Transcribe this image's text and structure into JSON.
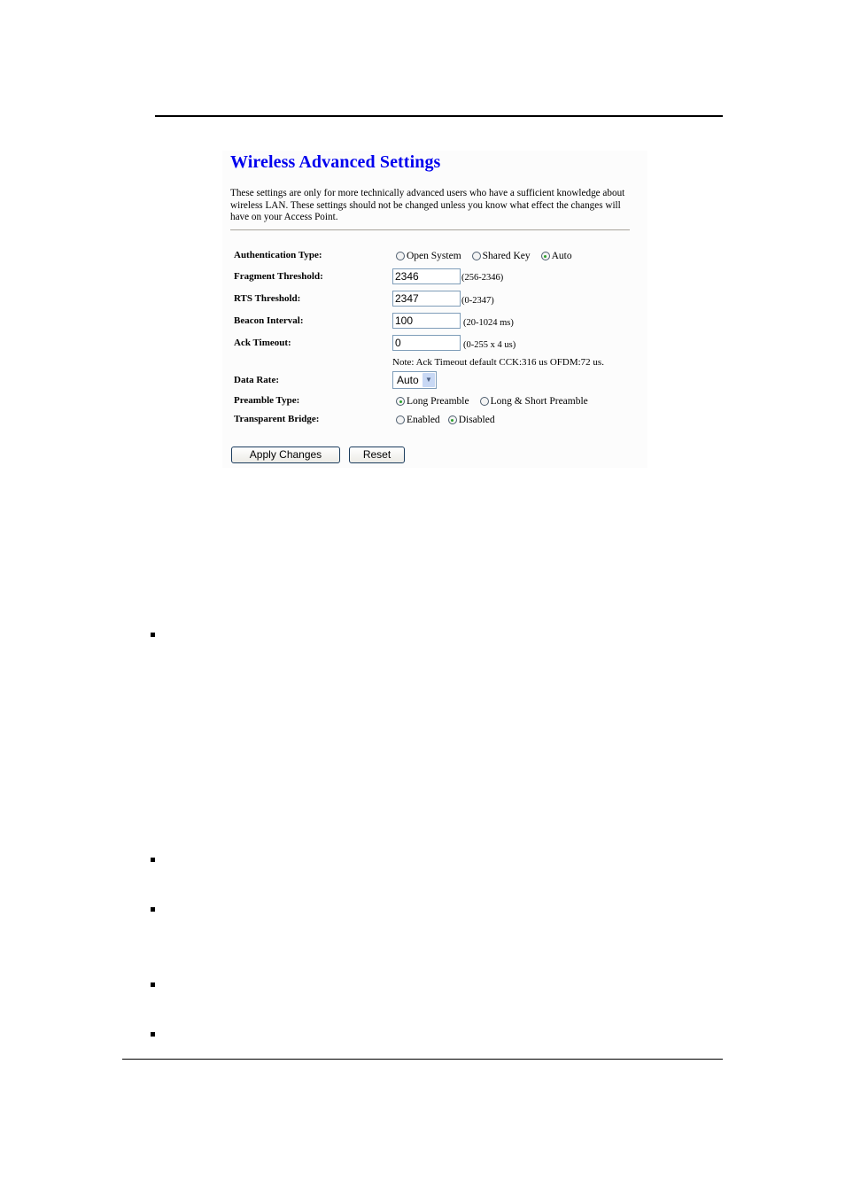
{
  "page": {
    "title": "Wireless Advanced Settings",
    "description": "These settings are only for more technically advanced users who have a sufficient knowledge about wireless LAN. These settings should not be changed unless you know what effect the changes will have on your Access Point."
  },
  "form": {
    "authentication_type": {
      "label": "Authentication Type:",
      "options": [
        "Open System",
        "Shared Key",
        "Auto"
      ],
      "selected": "Auto"
    },
    "fragment_threshold": {
      "label": "Fragment Threshold:",
      "value": "2346",
      "hint": "(256-2346)"
    },
    "rts_threshold": {
      "label": "RTS Threshold:",
      "value": "2347",
      "hint": "(0-2347)"
    },
    "beacon_interval": {
      "label": "Beacon Interval:",
      "value": "100",
      "hint": "(20-1024 ms)"
    },
    "ack_timeout": {
      "label": "Ack Timeout:",
      "value": "0",
      "hint": "(0-255 x 4 us)",
      "note": "Note: Ack Timeout default CCK:316 us OFDM:72 us."
    },
    "data_rate": {
      "label": "Data Rate:",
      "selected": "Auto"
    },
    "preamble_type": {
      "label": "Preamble Type:",
      "options": [
        "Long Preamble",
        "Long & Short Preamble"
      ],
      "selected": "Long Preamble"
    },
    "transparent_bridge": {
      "label": "Transparent Bridge:",
      "options": [
        "Enabled",
        "Disabled"
      ],
      "selected": "Disabled"
    }
  },
  "buttons": {
    "apply": "Apply Changes",
    "reset": "Reset"
  },
  "icons": {
    "dropdown": "chevron-down-icon",
    "bullet": "square-bullet-icon"
  },
  "colors": {
    "title": "#0000ee",
    "input_border": "#7f9db9",
    "radio_selected": "#2ba32b"
  }
}
